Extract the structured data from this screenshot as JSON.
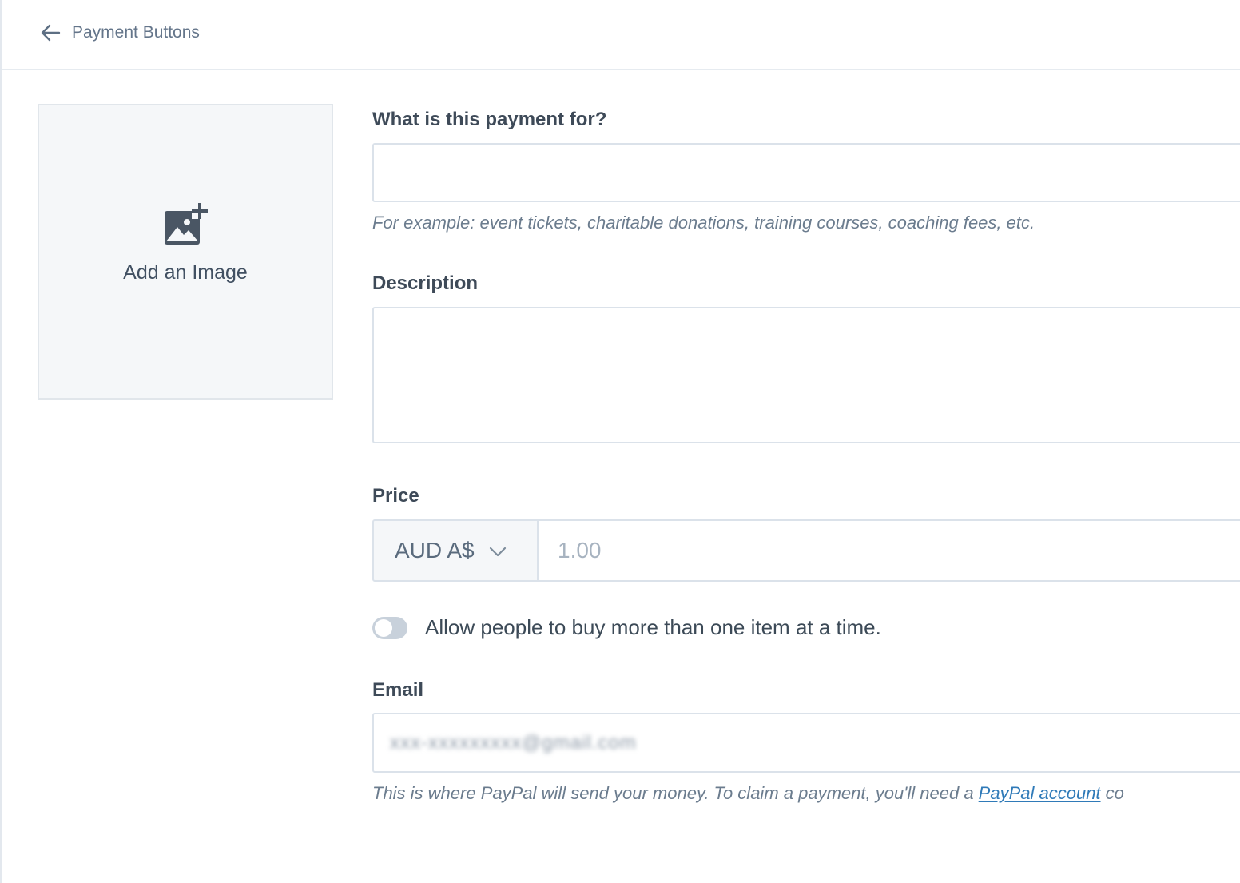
{
  "header": {
    "back_label": "Payment Buttons"
  },
  "image_upload": {
    "label": "Add an Image"
  },
  "form": {
    "payment_for": {
      "label": "What is this payment for?",
      "value": "",
      "hint": "For example: event tickets, charitable donations, training courses, coaching fees, etc."
    },
    "description": {
      "label": "Description",
      "value": ""
    },
    "price": {
      "label": "Price",
      "currency": "AUD A$",
      "placeholder": "1.00",
      "value": ""
    },
    "multi_item_toggle": {
      "label": "Allow people to buy more than one item at a time.",
      "enabled": false
    },
    "email": {
      "label": "Email",
      "value_obscured": "xxx-xxxxxxxxx@gmail.com",
      "hint_prefix": "This is where PayPal will send your money. To claim a payment, you'll need a ",
      "hint_link": "PayPal account",
      "hint_suffix": " co"
    }
  },
  "icons": {
    "back": "arrow-left-icon",
    "image_add": "image-add-icon",
    "dropdown": "chevron-down-icon"
  },
  "colors": {
    "link": "#2f7ab8",
    "toggle_off": "#c8d1db",
    "panel_bg": "#f5f7f9"
  }
}
